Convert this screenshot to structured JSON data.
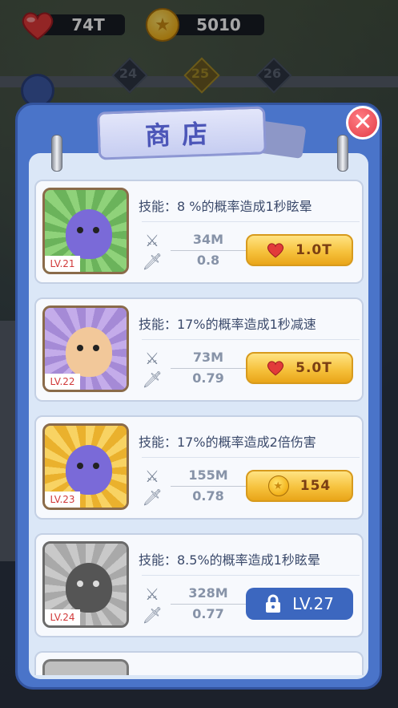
{
  "hud": {
    "hearts_value": "74T",
    "coins_value": "5010",
    "levels": [
      "24",
      "25",
      "26"
    ]
  },
  "shop": {
    "title": "商店",
    "close_label": "✕",
    "items": [
      {
        "level_tag": "LV.21",
        "skill": "技能：8 %的概率造成1秒眩晕",
        "attack": "34M",
        "speed": "0.8",
        "price": "1.0T",
        "currency_icon": "heart-icon",
        "portrait_color": "#7cc46a",
        "char_color": "#7a6ad8"
      },
      {
        "level_tag": "LV.22",
        "skill": "技能：17%的概率造成1秒减速",
        "attack": "73M",
        "speed": "0.79",
        "price": "5.0T",
        "currency_icon": "heart-icon",
        "portrait_color": "#b69ae0",
        "char_color": "#f2c89a"
      },
      {
        "level_tag": "LV.23",
        "skill": "技能：17%的概率造成2倍伤害",
        "attack": "155M",
        "speed": "0.78",
        "price": "154",
        "currency_icon": "coin-icon",
        "portrait_color": "#f3c33f",
        "char_color": "#7a6ad8"
      },
      {
        "level_tag": "LV.24",
        "skill": "技能：8.5%的概率造成1秒眩晕",
        "attack": "328M",
        "speed": "0.77",
        "locked_label": "LV.27",
        "portrait_color": "#b7b7b7",
        "char_color": "#555555"
      }
    ]
  },
  "colors": {
    "panel": "#4a74c9",
    "buy_button": "#f6c23d",
    "lock_button": "#3c67bf",
    "level_tag_text": "#d13a3a"
  }
}
